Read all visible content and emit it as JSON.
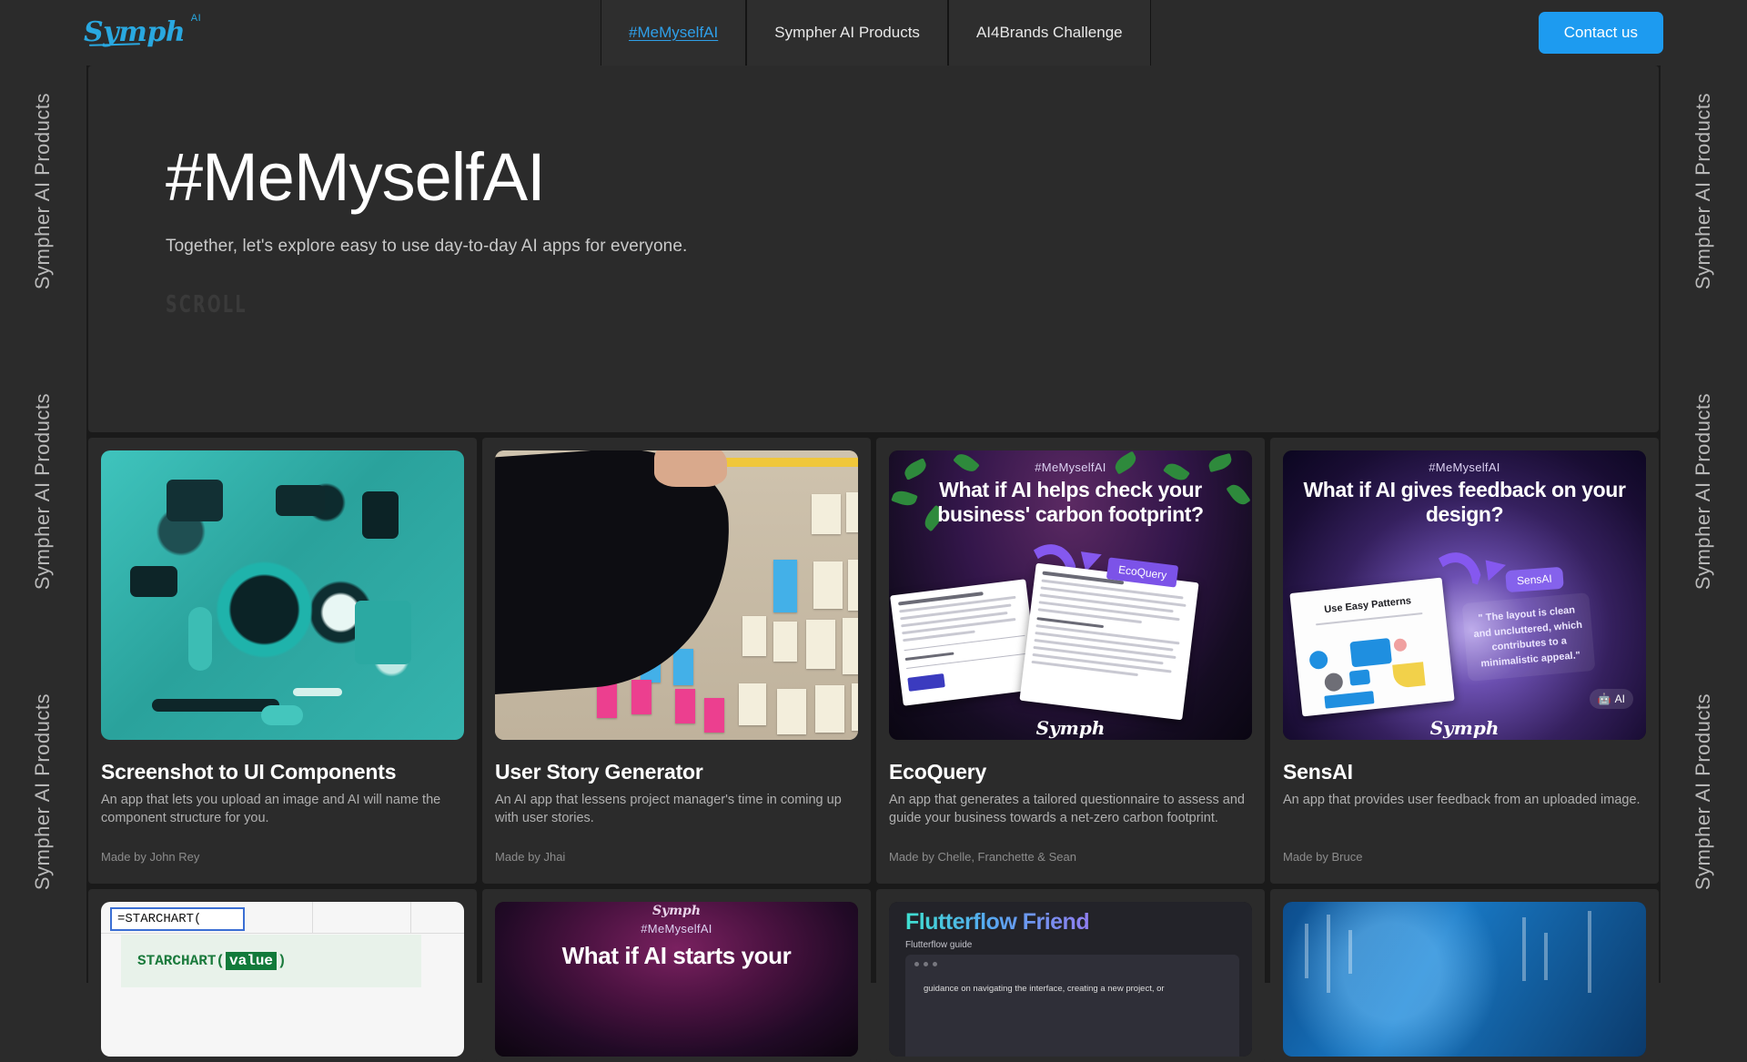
{
  "brand": {
    "name": "Symph",
    "superscript": "AI"
  },
  "nav": {
    "links": [
      {
        "label": "#MeMyselfAI",
        "active": true
      },
      {
        "label": "Sympher AI Products",
        "active": false
      },
      {
        "label": "AI4Brands Challenge",
        "active": false
      }
    ],
    "cta": "Contact us"
  },
  "rails": {
    "label": "Sympher AI Products"
  },
  "hero": {
    "title": "#MeMyselfAI",
    "subtitle": "Together, let's explore  easy to use day-to-day AI apps for everyone.",
    "scroll": "SCROLL"
  },
  "colors": {
    "accent_blue": "#1d9bf0",
    "logo_blue": "#29a8e0",
    "page_bg": "#1a1a1a",
    "card_bg": "#2b2b2b",
    "chrome_bg": "#2b2b2b",
    "purple": "#7c53e8"
  },
  "cards": [
    {
      "title": "Screenshot to UI Components",
      "description": "An app that lets you upload an image and AI will name the component structure for you.",
      "author": "Made by John Rey",
      "art": "teal-abstract-ui"
    },
    {
      "title": "User Story Generator",
      "description": "An AI app that lessens project manager's time in coming up with user stories.",
      "author": "Made by Jhai",
      "art": "sticky-notes-photo"
    },
    {
      "title": "EcoQuery",
      "description": "An app that generates a tailored questionnaire to assess and guide your business towards a net-zero carbon footprint.",
      "author": "Made by Chelle, Franchette & Sean",
      "art": "ecoquery-promo",
      "promo": {
        "tag": "#MeMyselfAI",
        "headline": "What if AI helps check your business' carbon footprint?",
        "badge": "EcoQuery",
        "logo": "Symph"
      }
    },
    {
      "title": "SensAI",
      "description": "An app that provides user feedback from an uploaded image.",
      "author": "Made by Bruce",
      "art": "sensai-promo",
      "promo": {
        "tag": "#MeMyselfAI",
        "headline": "What if AI gives feedback on your design?",
        "badge": "SensAI",
        "quote": "\" The layout is clean and uncluttered, which contributes to a minimalistic appeal.\"",
        "doc_title": "Use Easy Patterns",
        "bot_label": "AI",
        "logo": "Symph"
      }
    }
  ],
  "cards_row2": [
    {
      "art": "spreadsheet",
      "formula": "=STARCHART(",
      "suggestion_prefix": "STARCHART(",
      "suggestion_arg": "value",
      "suggestion_suffix": ")"
    },
    {
      "art": "purple-promo",
      "tag": "#MeMyselfAI",
      "headline": "What if AI starts your"
    },
    {
      "art": "flutterflow",
      "title": "Flutterflow Friend",
      "subtitle": "Flutterflow guide",
      "body": "guidance on navigating the interface, creating a new project, or"
    },
    {
      "art": "blue-tech"
    }
  ]
}
